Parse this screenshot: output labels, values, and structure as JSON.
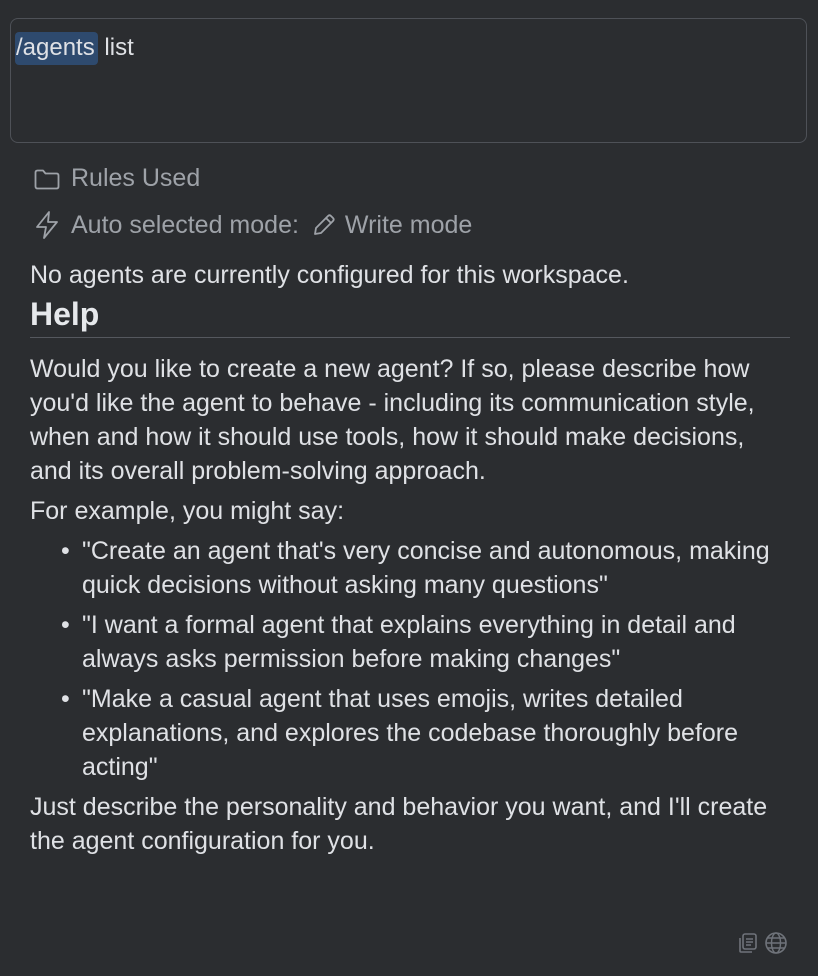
{
  "input": {
    "command": "/agents",
    "argument": " list"
  },
  "meta": {
    "rules_label": "Rules Used",
    "mode_label": "Auto selected mode:",
    "mode_value": "Write mode"
  },
  "response": {
    "status": "No agents are currently configured for this workspace.",
    "help_heading": "Help",
    "intro": "Would you like to create a new agent? If so, please describe how you'd like the agent to behave - including its communication style, when and how it should use tools, how it should make decisions, and its overall problem-solving approach.",
    "example_intro": "For example, you might say:",
    "examples": [
      "\"Create an agent that's very concise and autonomous, making quick decisions without asking many questions\"",
      "\"I want a formal agent that explains everything in detail and always asks permission before making changes\"",
      "\"Make a casual agent that uses emojis, writes detailed explanations, and explores the codebase thoroughly before acting\""
    ],
    "outro": "Just describe the personality and behavior you want, and I'll create the agent configuration for you."
  },
  "icons": {
    "rules": "folder-icon",
    "mode": "lightning-icon",
    "mode_value": "pencil-icon",
    "footer_copy": "copy-icon",
    "footer_globe": "globe-icon"
  },
  "colors": {
    "background": "#2b2d30",
    "text": "#dfe1e5",
    "muted": "#9ea2a8",
    "selection": "#2e4a6e"
  }
}
